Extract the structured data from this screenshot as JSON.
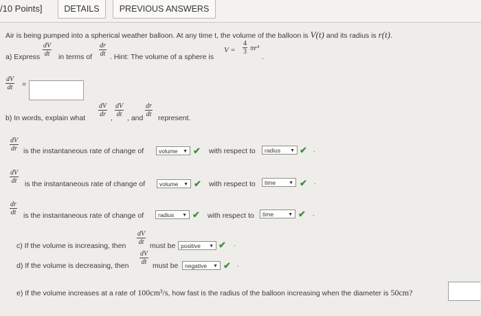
{
  "header": {
    "points": "/10 Points]",
    "details_tab": "DETAILS",
    "previous_answers_tab": "PREVIOUS ANSWERS"
  },
  "intro": {
    "text": "Air is being pumped into a spherical weather balloon. At any time t, the volume of the balloon is",
    "volume_symbol": "V(t)",
    "and_radius": "and its radius is",
    "radius_symbol": "r(t)",
    "end": "."
  },
  "part_a": {
    "label": "a) Express",
    "in_terms_of": "in terms of",
    "hint": ". Hint: The volume of a sphere is",
    "formula_lhs": "V =",
    "formula_rhs": "πr³",
    "formula_end": ".",
    "answer_label": "=",
    "answer_value": ""
  },
  "fractions": {
    "dV": "dV",
    "dr": "dr",
    "dt": "dt",
    "four": "4",
    "three": "3"
  },
  "part_b": {
    "label": "b) In words, explain what",
    "comma1": ",",
    "comma2": ", and",
    "represent": "represent.",
    "rows": [
      {
        "text": "is the instantaneous rate of change of",
        "sel1": "volume",
        "with_respect": "with respect to",
        "sel2": "radius"
      },
      {
        "text": "is the instantaneous rate of change of",
        "sel1": "volume",
        "with_respect": "with respect to",
        "sel2": "time"
      },
      {
        "text": "is the instantaneous rate of change of",
        "sel1": "radius",
        "with_respect": "with respect to",
        "sel2": "time"
      }
    ]
  },
  "part_c": {
    "text": "c) If the volume is increasing, then",
    "must_be": "must be",
    "selected": "positive"
  },
  "part_d": {
    "text": "d) If the volume is decreasing, then",
    "must_be": "must be",
    "selected": "negative"
  },
  "part_e": {
    "text_start": "e) If the volume increases at a rate of",
    "rate": "100cm³/s",
    "text_mid": ", how fast is the radius of the balloon increasing when the diameter is",
    "diameter": "50cm?",
    "answer_value": ""
  },
  "colors": {
    "check": "#3f8f3a",
    "background": "#efedea"
  }
}
